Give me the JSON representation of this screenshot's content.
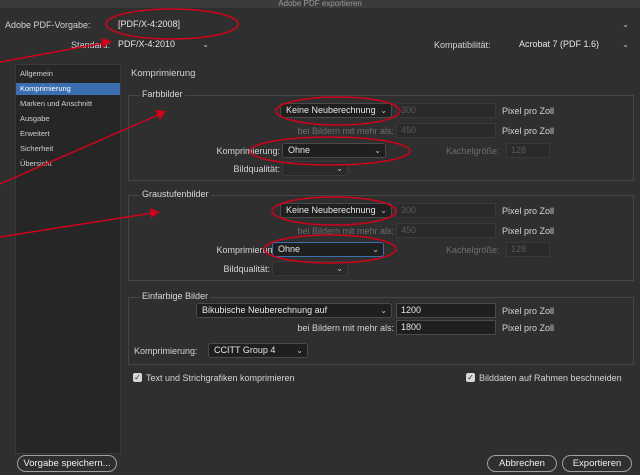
{
  "window": {
    "title": "Adobe PDF exportieren"
  },
  "preset": {
    "label": "Adobe PDF-Vorgabe:",
    "value": "[PDF/X-4:2008]"
  },
  "standard": {
    "label": "Standard:",
    "value": "PDF/X-4:2010"
  },
  "compat": {
    "label": "Kompatibilität:",
    "value": "Acrobat 7 (PDF 1.6)"
  },
  "sidebar": {
    "items": [
      {
        "label": "Allgemein"
      },
      {
        "label": "Komprimierung"
      },
      {
        "label": "Marken und Anschnitt"
      },
      {
        "label": "Ausgabe"
      },
      {
        "label": "Erweitert"
      },
      {
        "label": "Sicherheit"
      },
      {
        "label": "Übersicht"
      }
    ],
    "selected_index": 1
  },
  "panel": {
    "title": "Komprimierung"
  },
  "color_images": {
    "title": "Farbbilder",
    "resample": "Keine Neuberechnung",
    "resolution": "300",
    "unit": "Pixel pro Zoll",
    "above_label": "bei Bildern mit mehr als:",
    "above_value": "450",
    "above_unit": "Pixel pro Zoll",
    "compression_label": "Komprimierung:",
    "compression": "Ohne",
    "tile_label": "Kachelgröße:",
    "tile_value": "128",
    "quality_label": "Bildqualität:",
    "quality": ""
  },
  "gray_images": {
    "title": "Graustufenbilder",
    "resample": "Keine Neuberechnung",
    "resolution": "300",
    "unit": "Pixel pro Zoll",
    "above_label": "bei Bildern mit mehr als:",
    "above_value": "450",
    "above_unit": "Pixel pro Zoll",
    "compression_label": "Komprimierung:",
    "compression": "Ohne",
    "tile_label": "Kachelgröße:",
    "tile_value": "128",
    "quality_label": "Bildqualität:",
    "quality": ""
  },
  "mono_images": {
    "title": "Einfarbige Bilder",
    "resample": "Bikubische Neuberechnung auf",
    "resolution": "1200",
    "unit": "Pixel pro Zoll",
    "above_label": "bei Bildern mit mehr als:",
    "above_value": "1800",
    "above_unit": "Pixel pro Zoll",
    "compression_label": "Komprimierung:",
    "compression": "CCITT Group 4"
  },
  "options": {
    "compress_text": "Text und Strichgrafiken komprimieren",
    "crop_image": "Bilddaten auf Rahmen beschneiden"
  },
  "buttons": {
    "save_preset": "Vorgabe speichern...",
    "cancel": "Abbrechen",
    "export": "Exportieren"
  },
  "colors": {
    "background": "#2f2f2f",
    "selection": "#3b6db1",
    "annotation": "#d0021b"
  },
  "icons": {
    "dropdown": "chevron-down-icon",
    "checkbox": "checkmark-icon"
  }
}
